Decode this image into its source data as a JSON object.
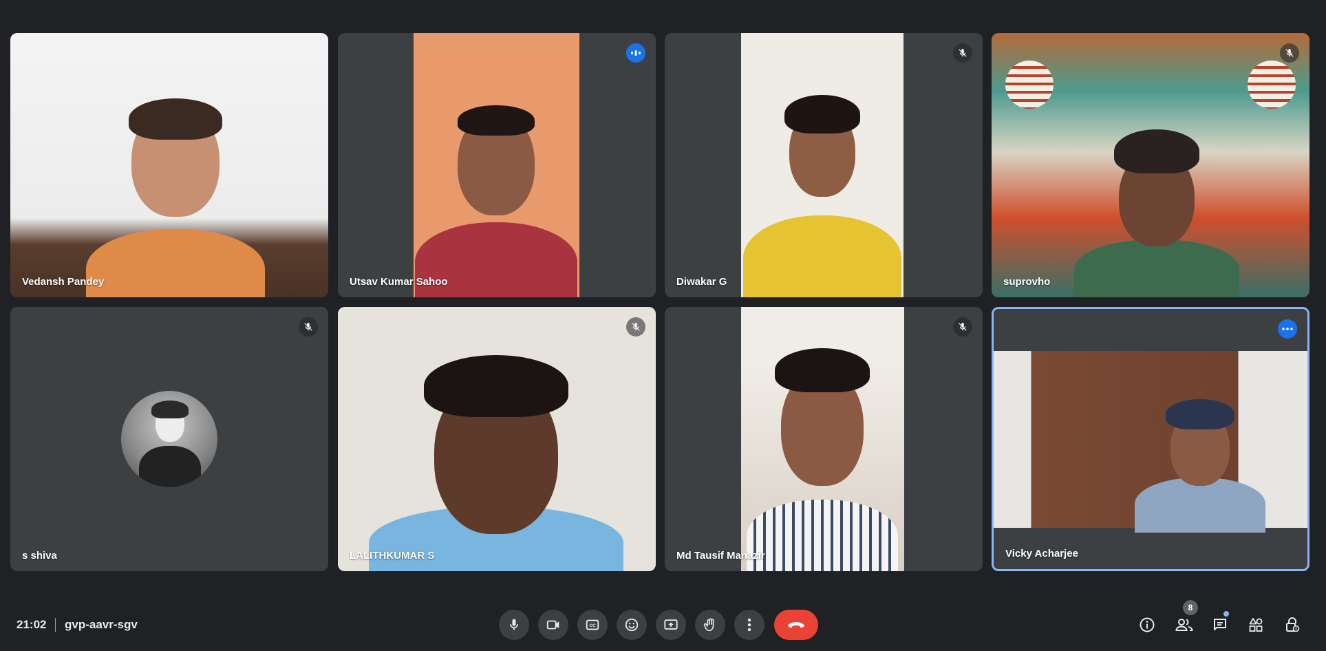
{
  "meeting": {
    "time": "21:02",
    "code": "gvp-aavr-sgv"
  },
  "participants": [
    {
      "name": "Vedansh Pandey",
      "status": "none"
    },
    {
      "name": "Utsav Kumar Sahoo",
      "status": "speaking"
    },
    {
      "name": "Diwakar G",
      "status": "muted"
    },
    {
      "name": "suprovho",
      "status": "muted"
    },
    {
      "name": "s shiva",
      "status": "muted"
    },
    {
      "name": "LALITHKUMAR S",
      "status": "muted"
    },
    {
      "name": "Md Tausif Manazir",
      "status": "muted"
    },
    {
      "name": "Vicky Acharjee",
      "status": "more-options"
    }
  ],
  "controls": [
    "mic-icon",
    "camera-icon",
    "captions-icon",
    "emoji-icon",
    "present-icon",
    "raise-hand-icon",
    "more-vert-icon",
    "end-call-icon"
  ],
  "right_controls": {
    "people_count": "8",
    "icons": [
      "info-icon",
      "people-icon",
      "chat-icon",
      "activities-icon",
      "host-controls-icon"
    ]
  },
  "colors": {
    "background": "#202124",
    "tile": "#3c4043",
    "accent": "#1a73e8",
    "end_call": "#ea4335",
    "active_border": "#8ab4f8"
  }
}
